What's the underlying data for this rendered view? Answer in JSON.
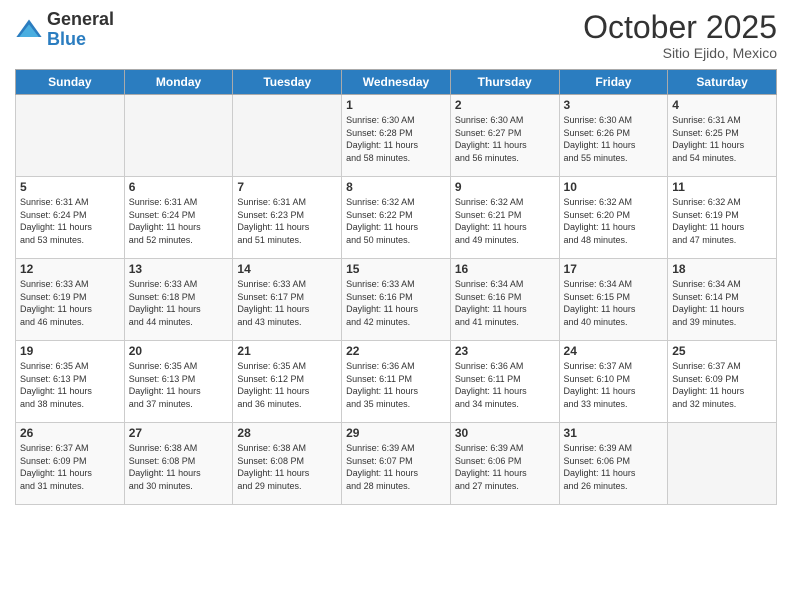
{
  "logo": {
    "general": "General",
    "blue": "Blue"
  },
  "header": {
    "month": "October 2025",
    "location": "Sitio Ejido, Mexico"
  },
  "days_of_week": [
    "Sunday",
    "Monday",
    "Tuesday",
    "Wednesday",
    "Thursday",
    "Friday",
    "Saturday"
  ],
  "weeks": [
    [
      {
        "day": "",
        "info": ""
      },
      {
        "day": "",
        "info": ""
      },
      {
        "day": "",
        "info": ""
      },
      {
        "day": "1",
        "info": "Sunrise: 6:30 AM\nSunset: 6:28 PM\nDaylight: 11 hours\nand 58 minutes."
      },
      {
        "day": "2",
        "info": "Sunrise: 6:30 AM\nSunset: 6:27 PM\nDaylight: 11 hours\nand 56 minutes."
      },
      {
        "day": "3",
        "info": "Sunrise: 6:30 AM\nSunset: 6:26 PM\nDaylight: 11 hours\nand 55 minutes."
      },
      {
        "day": "4",
        "info": "Sunrise: 6:31 AM\nSunset: 6:25 PM\nDaylight: 11 hours\nand 54 minutes."
      }
    ],
    [
      {
        "day": "5",
        "info": "Sunrise: 6:31 AM\nSunset: 6:24 PM\nDaylight: 11 hours\nand 53 minutes."
      },
      {
        "day": "6",
        "info": "Sunrise: 6:31 AM\nSunset: 6:24 PM\nDaylight: 11 hours\nand 52 minutes."
      },
      {
        "day": "7",
        "info": "Sunrise: 6:31 AM\nSunset: 6:23 PM\nDaylight: 11 hours\nand 51 minutes."
      },
      {
        "day": "8",
        "info": "Sunrise: 6:32 AM\nSunset: 6:22 PM\nDaylight: 11 hours\nand 50 minutes."
      },
      {
        "day": "9",
        "info": "Sunrise: 6:32 AM\nSunset: 6:21 PM\nDaylight: 11 hours\nand 49 minutes."
      },
      {
        "day": "10",
        "info": "Sunrise: 6:32 AM\nSunset: 6:20 PM\nDaylight: 11 hours\nand 48 minutes."
      },
      {
        "day": "11",
        "info": "Sunrise: 6:32 AM\nSunset: 6:19 PM\nDaylight: 11 hours\nand 47 minutes."
      }
    ],
    [
      {
        "day": "12",
        "info": "Sunrise: 6:33 AM\nSunset: 6:19 PM\nDaylight: 11 hours\nand 46 minutes."
      },
      {
        "day": "13",
        "info": "Sunrise: 6:33 AM\nSunset: 6:18 PM\nDaylight: 11 hours\nand 44 minutes."
      },
      {
        "day": "14",
        "info": "Sunrise: 6:33 AM\nSunset: 6:17 PM\nDaylight: 11 hours\nand 43 minutes."
      },
      {
        "day": "15",
        "info": "Sunrise: 6:33 AM\nSunset: 6:16 PM\nDaylight: 11 hours\nand 42 minutes."
      },
      {
        "day": "16",
        "info": "Sunrise: 6:34 AM\nSunset: 6:16 PM\nDaylight: 11 hours\nand 41 minutes."
      },
      {
        "day": "17",
        "info": "Sunrise: 6:34 AM\nSunset: 6:15 PM\nDaylight: 11 hours\nand 40 minutes."
      },
      {
        "day": "18",
        "info": "Sunrise: 6:34 AM\nSunset: 6:14 PM\nDaylight: 11 hours\nand 39 minutes."
      }
    ],
    [
      {
        "day": "19",
        "info": "Sunrise: 6:35 AM\nSunset: 6:13 PM\nDaylight: 11 hours\nand 38 minutes."
      },
      {
        "day": "20",
        "info": "Sunrise: 6:35 AM\nSunset: 6:13 PM\nDaylight: 11 hours\nand 37 minutes."
      },
      {
        "day": "21",
        "info": "Sunrise: 6:35 AM\nSunset: 6:12 PM\nDaylight: 11 hours\nand 36 minutes."
      },
      {
        "day": "22",
        "info": "Sunrise: 6:36 AM\nSunset: 6:11 PM\nDaylight: 11 hours\nand 35 minutes."
      },
      {
        "day": "23",
        "info": "Sunrise: 6:36 AM\nSunset: 6:11 PM\nDaylight: 11 hours\nand 34 minutes."
      },
      {
        "day": "24",
        "info": "Sunrise: 6:37 AM\nSunset: 6:10 PM\nDaylight: 11 hours\nand 33 minutes."
      },
      {
        "day": "25",
        "info": "Sunrise: 6:37 AM\nSunset: 6:09 PM\nDaylight: 11 hours\nand 32 minutes."
      }
    ],
    [
      {
        "day": "26",
        "info": "Sunrise: 6:37 AM\nSunset: 6:09 PM\nDaylight: 11 hours\nand 31 minutes."
      },
      {
        "day": "27",
        "info": "Sunrise: 6:38 AM\nSunset: 6:08 PM\nDaylight: 11 hours\nand 30 minutes."
      },
      {
        "day": "28",
        "info": "Sunrise: 6:38 AM\nSunset: 6:08 PM\nDaylight: 11 hours\nand 29 minutes."
      },
      {
        "day": "29",
        "info": "Sunrise: 6:39 AM\nSunset: 6:07 PM\nDaylight: 11 hours\nand 28 minutes."
      },
      {
        "day": "30",
        "info": "Sunrise: 6:39 AM\nSunset: 6:06 PM\nDaylight: 11 hours\nand 27 minutes."
      },
      {
        "day": "31",
        "info": "Sunrise: 6:39 AM\nSunset: 6:06 PM\nDaylight: 11 hours\nand 26 minutes."
      },
      {
        "day": "",
        "info": ""
      }
    ]
  ]
}
